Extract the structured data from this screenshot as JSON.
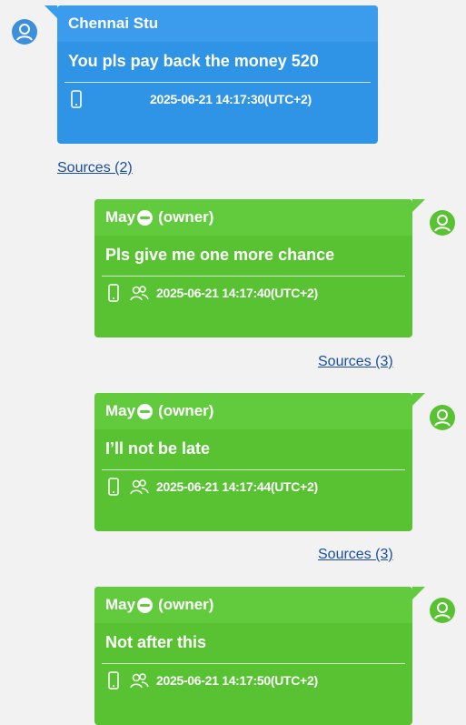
{
  "colors": {
    "blue": "#2f93e6",
    "green": "#58c233",
    "link": "#1a4fa0"
  },
  "messages": [
    {
      "sender": "Chennai Stu",
      "side": "left",
      "text": "You pls pay back the money 520",
      "timestamp": "2025-06-21 14:17:30(UTC+2)",
      "sources": "Sources (2)",
      "icons": [
        "phone-icon"
      ]
    },
    {
      "sender": "May",
      "role": "(owner)",
      "side": "right",
      "text": "Pls give me one more chance",
      "timestamp": "2025-06-21 14:17:40(UTC+2)",
      "sources": "Sources (3)",
      "icons": [
        "phone-icon",
        "contacts-icon"
      ]
    },
    {
      "sender": "May",
      "role": "(owner)",
      "side": "right",
      "text": "I’ll not be late",
      "timestamp": "2025-06-21 14:17:44(UTC+2)",
      "sources": "Sources (3)",
      "icons": [
        "phone-icon",
        "contacts-icon"
      ]
    },
    {
      "sender": "May",
      "role": "(owner)",
      "side": "right",
      "text": "Not after this",
      "timestamp": "2025-06-21 14:17:50(UTC+2)",
      "icons": [
        "phone-icon",
        "contacts-icon"
      ]
    }
  ]
}
